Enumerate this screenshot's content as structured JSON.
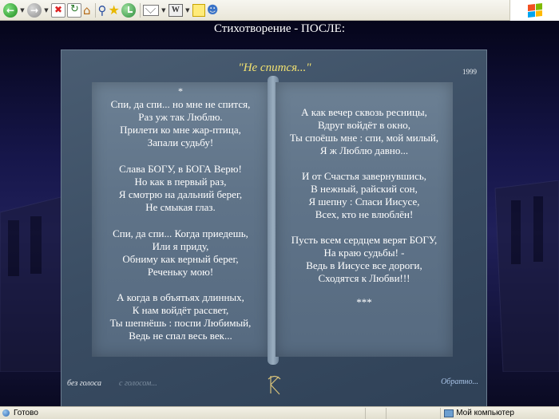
{
  "toolbar": {
    "items": [
      "back",
      "forward",
      "stop",
      "refresh",
      "home",
      "search",
      "favorites",
      "history",
      "mail",
      "print",
      "edit",
      "messenger"
    ],
    "print_glyph": "W"
  },
  "page": {
    "title": "Стихотворение - ПОСЛЕ:",
    "poem_title": "\"Не спится...\"",
    "year": "1999",
    "left_star": "*",
    "left_stanzas": [
      [
        "Спи, да спи... но мне не спится,",
        "Раз уж так Люблю.",
        "Прилети ко мне жар-птица,",
        "Запали судьбу!"
      ],
      [
        "Слава БОГУ, в БОГА Верю!",
        "Но как в первый раз,",
        "Я смотрю на дальний берег,",
        "Не смыкая глаз."
      ],
      [
        "Спи, да спи... Когда приедешь,",
        "Или я приду,",
        "Обниму как верный берег,",
        "Реченьку мою!"
      ],
      [
        "А когда в объятьях длинных,",
        "К нам войдёт рассвет,",
        "Ты шепнёшь : поспи Любимый,",
        "Ведь не спал весь век..."
      ]
    ],
    "right_stanzas": [
      [
        "А как вечер сквозь ресницы,",
        "Вдруг войдёт в окно,",
        "Ты споёшь мне : спи, мой милый,",
        "Я ж Люблю давно..."
      ],
      [
        "И от Счастья завернувшись,",
        "В нежный, райский сон,",
        "Я шепну : Спаси Иисусе,",
        "Всех, кто не влюблён!"
      ],
      [
        "Пусть всем сердцем верят БОГУ,",
        "На краю судьбы!  -",
        "Ведь в Иисусе все дороги,",
        "Сходятся к Любви!!!"
      ]
    ],
    "right_end": "***",
    "link_no_voice": "без голоса",
    "link_with_voice": "с голосом...",
    "link_back": "Обратно..."
  },
  "status": {
    "text": "Готово",
    "zone": "Мой компьютер"
  }
}
